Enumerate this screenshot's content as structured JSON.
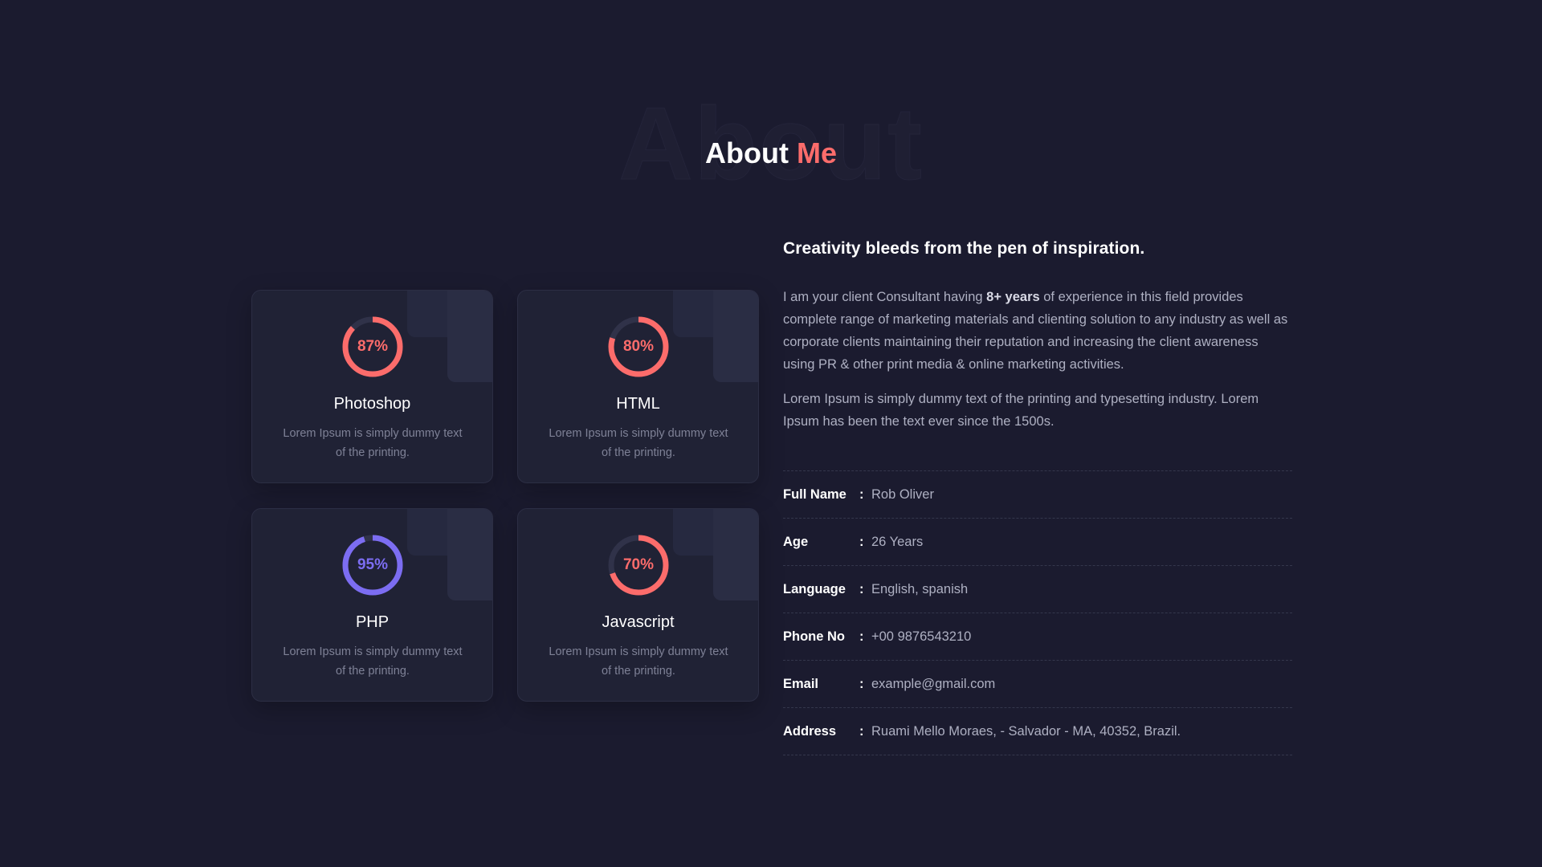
{
  "section": {
    "bg_word": "About",
    "title_main": "About",
    "title_accent": "Me"
  },
  "colors": {
    "accent": "#fc6c6b",
    "purple": "#7c6df2",
    "ring_track": "#303249"
  },
  "skills": [
    {
      "percent": 87,
      "percent_label": "87%",
      "name": "Photoshop",
      "desc": "Lorem Ipsum is simply dummy text of the printing.",
      "color": "#fc6c6b"
    },
    {
      "percent": 80,
      "percent_label": "80%",
      "name": "HTML",
      "desc": "Lorem Ipsum is simply dummy text of the printing.",
      "color": "#fc6c6b"
    },
    {
      "percent": 95,
      "percent_label": "95%",
      "name": "PHP",
      "desc": "Lorem Ipsum is simply dummy text of the printing.",
      "color": "#7c6df2"
    },
    {
      "percent": 70,
      "percent_label": "70%",
      "name": "Javascript",
      "desc": "Lorem Ipsum is simply dummy text of the printing.",
      "color": "#fc6c6b"
    }
  ],
  "about": {
    "tagline": "Creativity bleeds from the pen of inspiration.",
    "para1_before": "I am your client Consultant having ",
    "para1_bold": "8+ years",
    "para1_after": " of experience in this field provides complete range of marketing materials and clienting solution to any industry as well as corporate clients maintaining their reputation and increasing the client awareness using PR & other print media & online marketing activities.",
    "para2": "Lorem Ipsum is simply dummy text of the printing and typesetting industry. Lorem Ipsum has been the text ever since the 1500s.",
    "separator": ":",
    "details": [
      {
        "label": "Full Name",
        "value": "Rob Oliver"
      },
      {
        "label": "Age",
        "value": "26 Years"
      },
      {
        "label": "Language",
        "value": "English, spanish"
      },
      {
        "label": "Phone No",
        "value": "+00 9876543210"
      },
      {
        "label": "Email",
        "value": "example@gmail.com"
      },
      {
        "label": "Address",
        "value": "Ruami Mello Moraes, - Salvador - MA, 40352, Brazil."
      }
    ]
  }
}
